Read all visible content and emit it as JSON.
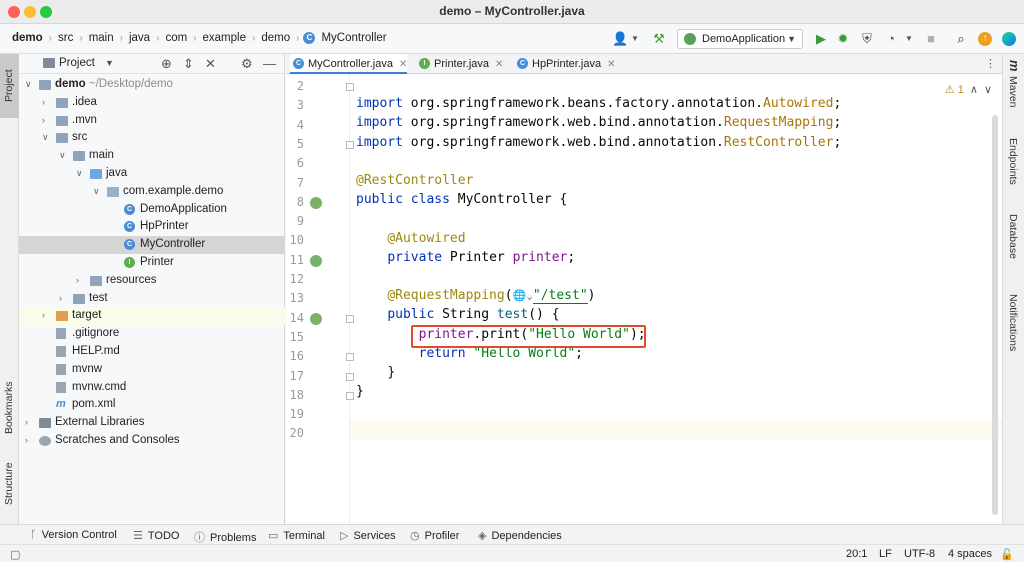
{
  "window": {
    "title": "demo – MyController.java"
  },
  "breadcrumbs": [
    "demo",
    "src",
    "main",
    "java",
    "com",
    "example",
    "demo",
    "MyController"
  ],
  "toolbar": {
    "run_config": "DemoApplication"
  },
  "left_strip": {
    "project": "Project",
    "bookmarks": "Bookmarks",
    "structure": "Structure"
  },
  "right_strip": {
    "maven": "Maven",
    "endpoints": "Endpoints",
    "database": "Database",
    "notifications": "Notifications"
  },
  "project_panel": {
    "title": "Project",
    "tree": [
      {
        "label": "demo",
        "suffix": "~/Desktop/demo",
        "indent": 0,
        "arrow": "down",
        "icon": "folder"
      },
      {
        "label": ".idea",
        "indent": 1,
        "arrow": "right",
        "icon": "folder"
      },
      {
        "label": ".mvn",
        "indent": 1,
        "arrow": "right",
        "icon": "folder"
      },
      {
        "label": "src",
        "indent": 1,
        "arrow": "down",
        "icon": "folder"
      },
      {
        "label": "main",
        "indent": 2,
        "arrow": "down",
        "icon": "folder"
      },
      {
        "label": "java",
        "indent": 3,
        "arrow": "down",
        "icon": "folder-blue"
      },
      {
        "label": "com.example.demo",
        "indent": 4,
        "arrow": "down",
        "icon": "package"
      },
      {
        "label": "DemoApplication",
        "indent": 5,
        "arrow": "",
        "icon": "class"
      },
      {
        "label": "HpPrinter",
        "indent": 5,
        "arrow": "",
        "icon": "class"
      },
      {
        "label": "MyController",
        "indent": 5,
        "arrow": "",
        "icon": "class",
        "selected": true
      },
      {
        "label": "Printer",
        "indent": 5,
        "arrow": "",
        "icon": "interface"
      },
      {
        "label": "resources",
        "indent": 3,
        "arrow": "right",
        "icon": "folder"
      },
      {
        "label": "test",
        "indent": 2,
        "arrow": "right",
        "icon": "folder"
      },
      {
        "label": "target",
        "indent": 1,
        "arrow": "right",
        "icon": "folder-orange",
        "highlight": true
      },
      {
        "label": ".gitignore",
        "indent": 1,
        "arrow": "",
        "icon": "file"
      },
      {
        "label": "HELP.md",
        "indent": 1,
        "arrow": "",
        "icon": "file"
      },
      {
        "label": "mvnw",
        "indent": 1,
        "arrow": "",
        "icon": "file"
      },
      {
        "label": "mvnw.cmd",
        "indent": 1,
        "arrow": "",
        "icon": "file"
      },
      {
        "label": "pom.xml",
        "indent": 1,
        "arrow": "",
        "icon": "maven-file"
      },
      {
        "label": "External Libraries",
        "indent": 0,
        "arrow": "right",
        "icon": "library"
      },
      {
        "label": "Scratches and Consoles",
        "indent": 0,
        "arrow": "right",
        "icon": "scratch"
      }
    ]
  },
  "editor_tabs": [
    {
      "label": "MyController.java",
      "icon": "class",
      "active": true
    },
    {
      "label": "Printer.java",
      "icon": "interface",
      "active": false
    },
    {
      "label": "HpPrinter.java",
      "icon": "class",
      "active": false
    }
  ],
  "editor": {
    "inspection": "1",
    "line_numbers": [
      "2",
      "3",
      "4",
      "5",
      "6",
      "7",
      "8",
      "9",
      "10",
      "11",
      "12",
      "13",
      "14",
      "15",
      "16",
      "17",
      "18",
      "19",
      "20"
    ],
    "code": {
      "l3a": "import",
      "l3b": " org.springframework.beans.factory.annotation.",
      "l3c": "Autowired",
      "l3d": ";",
      "l4a": "import",
      "l4b": " org.springframework.web.bind.annotation.",
      "l4c": "RequestMapping",
      "l4d": ";",
      "l5a": "import",
      "l5b": " org.springframework.web.bind.annotation.",
      "l5c": "RestController",
      "l5d": ";",
      "l7": "@RestController",
      "l8a": "public class",
      "l8b": " MyController {",
      "l10": "@Autowired",
      "l11a": "private",
      "l11b": " Printer ",
      "l11c": "printer",
      "l11d": ";",
      "l13a": "@RequestMapping",
      "l13b": "(",
      "l13c": "\"/test\"",
      "l13d": ")",
      "l14a": "public",
      "l14b": " String ",
      "l14c": "test",
      "l14d": "() {",
      "l15a": "printer",
      "l15b": ".print(",
      "l15c": "\"Hello World\"",
      "l15d": ");",
      "l16a": "return",
      "l16b": " ",
      "l16c": "\"Hello World\"",
      "l16d": ";",
      "l17": "}",
      "l18": "}"
    }
  },
  "bottom_tools": [
    "Version Control",
    "TODO",
    "Problems",
    "Terminal",
    "Services",
    "Profiler",
    "Dependencies"
  ],
  "status": {
    "position": "20:1",
    "line_sep": "LF",
    "encoding": "UTF-8",
    "indent": "4 spaces"
  }
}
